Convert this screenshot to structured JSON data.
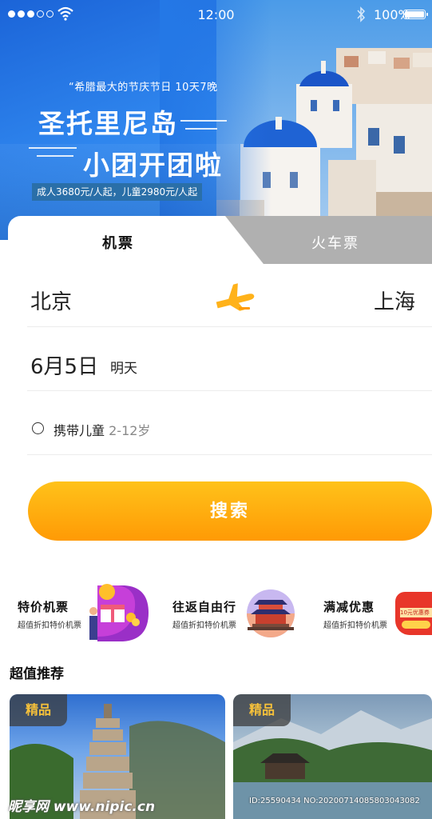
{
  "status_bar": {
    "time": "12:00",
    "battery": "100%"
  },
  "hero": {
    "subtitle": "“希腊最大的节庆节日 10天7晚",
    "title_line1": "圣托里尼岛",
    "title_line2": "小团开团啦",
    "price": "成人3680元/人起，儿童2980元/人起"
  },
  "tabs": {
    "flight": "机票",
    "train": "火车票"
  },
  "booking": {
    "from_city": "北京",
    "to_city": "上海",
    "date": "6月5日",
    "date_tag": "明天",
    "child_label": "携带儿童",
    "child_age": "2-12岁",
    "search_label": "搜索"
  },
  "promos": [
    {
      "title": "特价机票",
      "desc": "超值折扣特价机票"
    },
    {
      "title": "往返自由行",
      "desc": "超值折扣特价机票"
    },
    {
      "title": "满减优惠",
      "desc": "超值折扣特价机票",
      "art_text": "10元优惠券"
    }
  ],
  "section_title": "超值推荐",
  "recommendations": [
    {
      "badge": "精品"
    },
    {
      "badge": "精品"
    }
  ],
  "watermark": {
    "logo": "昵享网 www.nipic.cn",
    "id": "ID:25590434 NO:20200714085803043082"
  },
  "colors": {
    "accent": "#ffa90f",
    "hero_blue": "#2f86ee",
    "tab_inactive": "#b0b0b0",
    "badge_text": "#f6c13a"
  }
}
